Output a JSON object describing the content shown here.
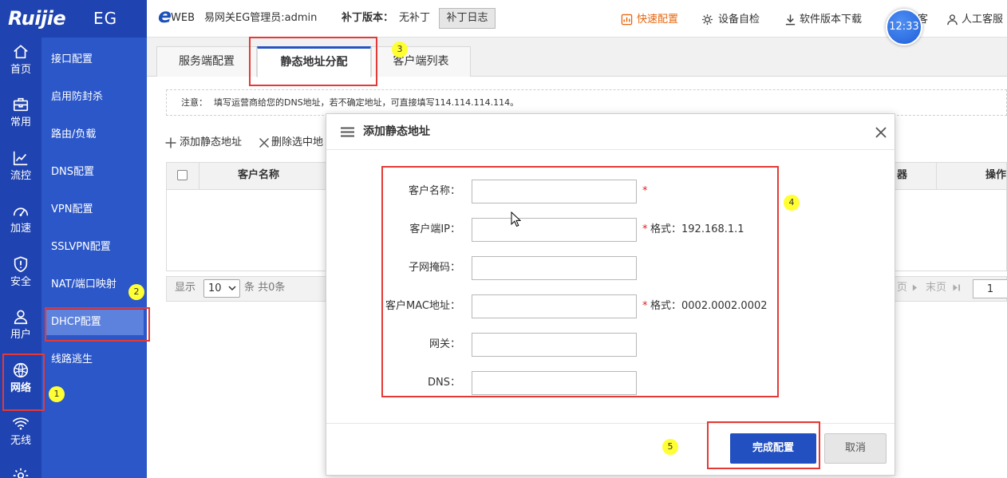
{
  "logo": {
    "brand": "Ruijie",
    "product": "EG"
  },
  "header": {
    "eweb_e": "e",
    "eweb_web": "WEB",
    "admin_text": "易网关EG管理员:admin",
    "patch_label": "补丁版本：",
    "patch_value": "无补丁",
    "patch_log_button": "补丁日志",
    "quick_config": "快速配置",
    "quick_config_icon": "dashboard-icon",
    "self_check": "设备自检",
    "self_check_icon": "diagnostic-icon",
    "software_download": "软件版本下载",
    "software_download_icon": "download-icon",
    "clock_time": "12:33",
    "partial_item": "客",
    "support": "人工客服",
    "support_icon": "person-icon"
  },
  "nav": {
    "selected_index": 6,
    "items": [
      {
        "label": "首页",
        "icon": "home-icon"
      },
      {
        "label": "常用",
        "icon": "toolbox-icon"
      },
      {
        "label": "流控",
        "icon": "line-chart-icon"
      },
      {
        "label": "加速",
        "icon": "speedometer-icon"
      },
      {
        "label": "安全",
        "icon": "shield-icon"
      },
      {
        "label": "用户",
        "icon": "user-icon"
      },
      {
        "label": "网络",
        "icon": "network-icon"
      },
      {
        "label": "无线",
        "icon": "wifi-icon"
      },
      {
        "label": "",
        "icon": "gear-icon"
      }
    ]
  },
  "submenu": {
    "selected_index": 7,
    "items": [
      "接口配置",
      "启用防封杀",
      "路由/负载",
      "DNS配置",
      "VPN配置",
      "SSLVPN配置",
      "NAT/端口映射",
      "DHCP配置",
      "线路逃生"
    ]
  },
  "tabs": {
    "active_index": 1,
    "items": [
      "服务端配置",
      "静态地址分配",
      "客户端列表"
    ]
  },
  "notice": {
    "label": "注意：",
    "text": "填写运营商给您的DNS地址，若不确定地址，可直接填写114.114.114.114。"
  },
  "toolbar": {
    "add_label": "添加静态地址",
    "add_icon": "plus-icon",
    "delete_label": "删除选中地",
    "delete_icon": "x-icon"
  },
  "table": {
    "columns": [
      "客户名称",
      "器",
      "操作"
    ],
    "rows": []
  },
  "pagination": {
    "show_label": "显示",
    "page_size": "10",
    "count_text": "条 共0条",
    "next_partial": "页",
    "last_label": "末页",
    "current_page": "1"
  },
  "modal": {
    "title": "添加静态地址",
    "required_mark": "*",
    "fields": [
      {
        "label": "客户名称：",
        "value": "",
        "required": true,
        "hint": ""
      },
      {
        "label": "客户端IP：",
        "value": "",
        "required": true,
        "hint": "格式：192.168.1.1"
      },
      {
        "label": "子网掩码：",
        "value": "",
        "required": false,
        "hint": ""
      },
      {
        "label": "客户MAC地址：",
        "value": "",
        "required": true,
        "hint": "格式：0002.0002.0002"
      },
      {
        "label": "网关：",
        "value": "",
        "required": false,
        "hint": ""
      },
      {
        "label": "DNS：",
        "value": "",
        "required": false,
        "hint": ""
      }
    ],
    "confirm_button": "完成配置",
    "cancel_button": "取消"
  },
  "annotations": [
    "1",
    "2",
    "3",
    "4",
    "5"
  ],
  "colors": {
    "brand_blue": "#1f43b0",
    "submenu_blue": "#2b57c9",
    "submenu_selected": "#5d82dd",
    "accent": "#2350c0",
    "quick_config_orange": "#e8650c",
    "annotation_red": "#e53935",
    "annotation_yellow": "#ffff33",
    "required_red": "#e02020"
  }
}
